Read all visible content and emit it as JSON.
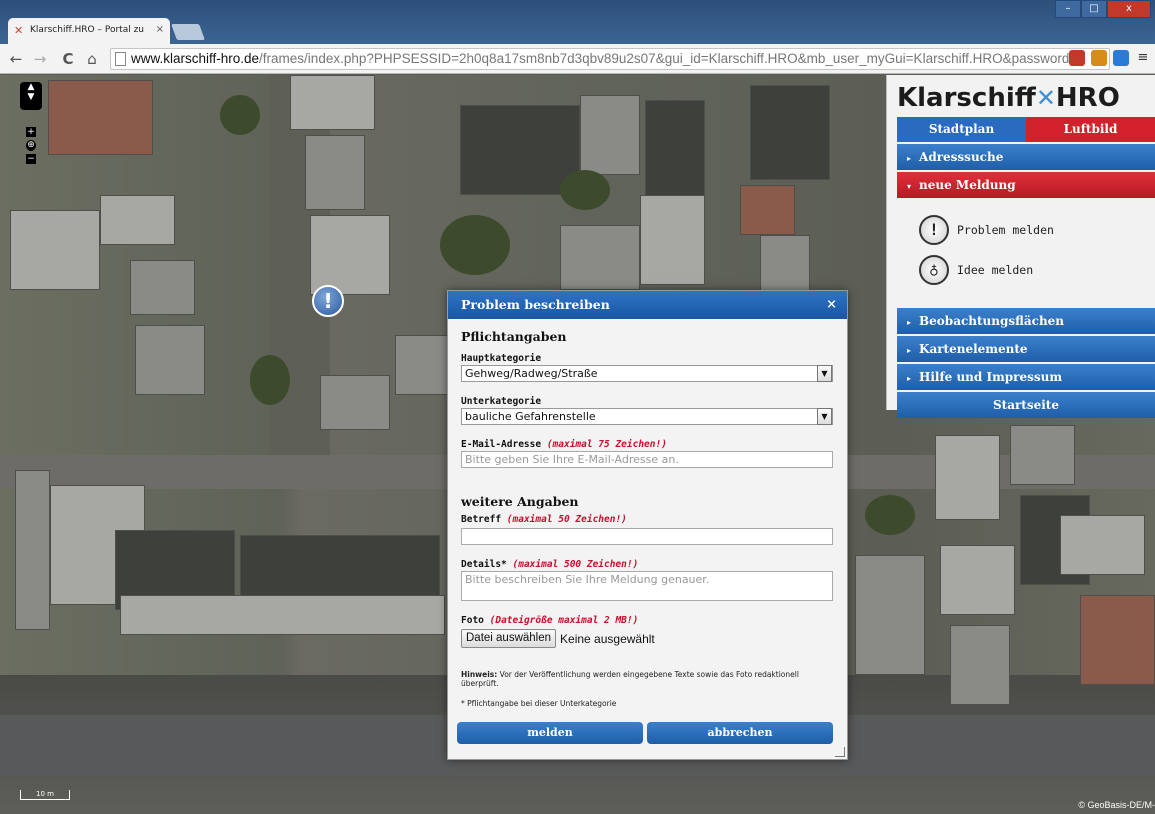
{
  "browser": {
    "tab_title": "Klarschiff.HRO – Portal zu",
    "tab_close": "×",
    "url_host": "www.klarschiff-hro.de",
    "url_rest": "/frames/index.php?PHPSESSID=2h0q8a17sm8nb7d3qbv89u2s07&gui_id=Klarschiff.HRO&mb_user_myGui=Klarschiff.HRO&password=",
    "back": "←",
    "forward": "→",
    "reload": "C",
    "home": "⌂",
    "menu": "≡",
    "win_min": "–",
    "win_max": "□",
    "win_close": "x"
  },
  "map": {
    "scale_label": "10 m",
    "copyright": "© GeoBasis-DE/M-",
    "zoom_in": "+",
    "zoom_out": "−",
    "marker_symbol": "!"
  },
  "panel": {
    "logo_left": "Klarschiff",
    "logo_right": "HRO",
    "tab_stadtplan": "Stadtplan",
    "tab_luftbild": "Luftbild",
    "adresssuche": "Adresssuche",
    "neue_meldung": "neue Meldung",
    "problem_melden": "Problem melden",
    "idee_melden": "Idee melden",
    "beobachtungsflaechen": "Beobachtungsflächen",
    "kartenelemente": "Kartenelemente",
    "hilfe": "Hilfe und Impressum",
    "startseite": "Startseite",
    "caret_closed": "▸",
    "caret_open": "▾"
  },
  "dialog": {
    "title": "Problem beschreiben",
    "close": "×",
    "pflicht_heading": "Pflichtangaben",
    "hauptkategorie_label": "Hauptkategorie",
    "hauptkategorie_value": "Gehweg/Radweg/Straße",
    "unterkategorie_label": "Unterkategorie",
    "unterkategorie_value": "bauliche Gefahrenstelle",
    "email_label": "E-Mail-Adresse",
    "email_hint": "(maximal 75 Zeichen!)",
    "email_placeholder": "Bitte geben Sie Ihre E-Mail-Adresse an.",
    "weitere_heading": "weitere Angaben",
    "betreff_label": "Betreff",
    "betreff_hint": "(maximal 50 Zeichen!)",
    "details_label": "Details*",
    "details_hint": "(maximal 500 Zeichen!)",
    "details_placeholder": "Bitte beschreiben Sie Ihre Meldung genauer.",
    "foto_label": "Foto",
    "foto_hint": "(Dateigröße maximal 2 MB!)",
    "file_button": "Datei auswählen",
    "file_status": "Keine ausgewählt",
    "hinweis_bold": "Hinweis:",
    "hinweis_text": "Vor der Veröffentlichung werden eingegebene Texte sowie das Foto redaktionell überprüft.",
    "pflicht_note": "* Pflichtangabe bei dieser Unterkategorie",
    "submit": "melden",
    "cancel": "abbrechen"
  },
  "colors": {
    "accent_blue": "#1f5ea8",
    "accent_red": "#d0212c",
    "hint_red": "#c8102e"
  }
}
